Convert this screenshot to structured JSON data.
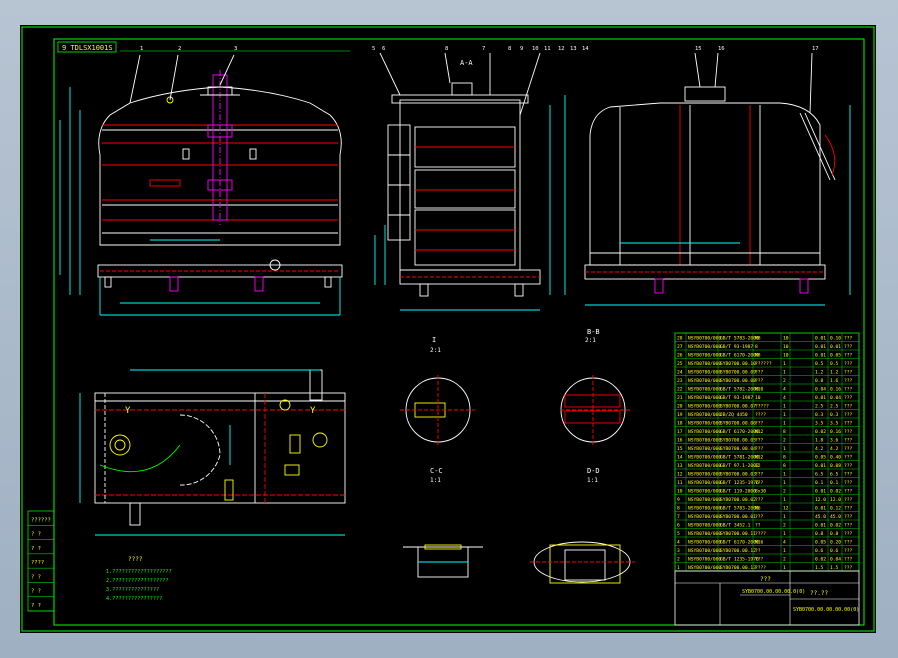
{
  "drawing": {
    "drawing_number": "9 TDLSX1001S",
    "section_label_aa": "A-A",
    "section_label_bb": "B-B",
    "scale_label": "1:1",
    "view_ratio": "2:1",
    "section_cc": "C-C",
    "section_dd": "D-D",
    "title_block": {
      "code": "SYB0700.00.00.00.0(0)",
      "name": "???",
      "scale_note": "??.??",
      "sheet_code": "SYB0700.00.00.00.00(0)"
    },
    "left_table_rows": [
      "??????",
      "? ?",
      "? ?",
      "????",
      "? ?",
      "? ?",
      "? ?"
    ],
    "notes_title": "????",
    "notes": [
      "1.???????????????????",
      "2.??????????????????",
      "3.???????????????",
      "4.????????????????"
    ],
    "balloons_top": [
      "1",
      "2",
      "3",
      "5",
      "6",
      "8",
      "7",
      "8",
      "9",
      "10",
      "11",
      "12",
      "13",
      "14",
      "15",
      "16",
      "17"
    ],
    "bom_rows": [
      [
        "28",
        "NSYB0700/000",
        "GB/T 5783-2000",
        "M8",
        "10",
        "",
        "0.01",
        "0.10",
        "???"
      ],
      [
        "27",
        "NSYB0700/000",
        "GB/T 93-1987",
        "8",
        "10",
        "",
        "0.01",
        "0.01",
        "???"
      ],
      [
        "26",
        "NSYB0700/000",
        "GB/T 6170-2000",
        "M8",
        "10",
        "",
        "0.01",
        "0.05",
        "???"
      ],
      [
        "25",
        "NSYB0700/000",
        "SYB0700.00.10",
        "??????",
        "1",
        "",
        "0.5",
        "0.5",
        "???"
      ],
      [
        "24",
        "NSYB0700/000",
        "SYB0700.00.09",
        "???",
        "1",
        "",
        "1.2",
        "1.2",
        "???"
      ],
      [
        "23",
        "NSYB0700/000",
        "SYB0700.00.08",
        "???",
        "2",
        "",
        "0.8",
        "1.6",
        "???"
      ],
      [
        "22",
        "NSYB0700/000",
        "GB/T 5782-2000",
        "M10",
        "4",
        "",
        "0.04",
        "0.16",
        "???"
      ],
      [
        "21",
        "NSYB0700/000",
        "GB/T 93-1987",
        "10",
        "4",
        "",
        "0.01",
        "0.04",
        "???"
      ],
      [
        "20",
        "NSYB0700/000",
        "SYB0700.00.07",
        "?????",
        "1",
        "",
        "2.5",
        "2.5",
        "???"
      ],
      [
        "19",
        "NSYB0700/000",
        "JB/ZQ 4450",
        "????",
        "1",
        "",
        "0.3",
        "0.3",
        "???"
      ],
      [
        "18",
        "NSYB0700/000",
        "SYB0700.00.06",
        "???",
        "1",
        "",
        "3.5",
        "3.5",
        "???"
      ],
      [
        "17",
        "NSYB0700/000",
        "GB/T 6170-2000",
        "M12",
        "8",
        "",
        "0.02",
        "0.16",
        "???"
      ],
      [
        "16",
        "NSYB0700/000",
        "SYB0700.00.05",
        "???",
        "2",
        "",
        "1.8",
        "3.6",
        "???"
      ],
      [
        "15",
        "NSYB0700/000",
        "SYB0700.00.04",
        "???",
        "1",
        "",
        "4.2",
        "4.2",
        "???"
      ],
      [
        "14",
        "NSYB0700/000",
        "GB/T 5781-2000",
        "M12",
        "8",
        "",
        "0.05",
        "0.40",
        "???"
      ],
      [
        "13",
        "NSYB0700/000",
        "GB/T 97.1-2002",
        "12",
        "8",
        "",
        "0.01",
        "0.08",
        "???"
      ],
      [
        "12",
        "NSYB0700/000",
        "SYB0700.00.03",
        "???",
        "1",
        "",
        "6.5",
        "6.5",
        "???"
      ],
      [
        "11",
        "NSYB0700/000",
        "GB/T 1235-1976",
        "???",
        "1",
        "",
        "0.1",
        "0.1",
        "???"
      ],
      [
        "10",
        "NSYB0700/000",
        "GB/T 119-2000",
        "8x30",
        "2",
        "",
        "0.01",
        "0.02",
        "???"
      ],
      [
        "9",
        "NSYB0700/000",
        "SYB0700.00.02",
        "???",
        "1",
        "",
        "12.0",
        "12.0",
        "???"
      ],
      [
        "8",
        "NSYB0700/000",
        "GB/T 5783-2000",
        "M6",
        "12",
        "",
        "0.01",
        "0.12",
        "???"
      ],
      [
        "7",
        "NSYB0700/000",
        "SYB0700.00.01",
        "???",
        "1",
        "",
        "45.0",
        "45.0",
        "???"
      ],
      [
        "6",
        "NSYB0700/000",
        "GB/T 3452.1",
        "??",
        "2",
        "",
        "0.01",
        "0.02",
        "???"
      ],
      [
        "5",
        "NSYB0700/000",
        "SYB0700.00.11",
        "????",
        "1",
        "",
        "0.8",
        "0.8",
        "???"
      ],
      [
        "4",
        "NSYB0700/000",
        "GB/T 6170-2000",
        "M16",
        "4",
        "",
        "0.05",
        "0.20",
        "???"
      ],
      [
        "3",
        "NSYB0700/000",
        "SYB0700.00.12",
        "??",
        "1",
        "",
        "0.6",
        "0.6",
        "???"
      ],
      [
        "2",
        "NSYB0700/000",
        "GB/T 1235-1976",
        "???",
        "2",
        "",
        "0.02",
        "0.04",
        "???"
      ],
      [
        "1",
        "NSYB0700/000",
        "SYB0700.00.13",
        "????",
        "1",
        "",
        "1.5",
        "1.5",
        "???"
      ]
    ],
    "colors": {
      "frame": "#00ff00",
      "dimension": "#00ffff",
      "outline": "#ffffff",
      "hidden": "#ff0000",
      "highlight": "#ff00ff",
      "annotation": "#ffff00"
    }
  }
}
